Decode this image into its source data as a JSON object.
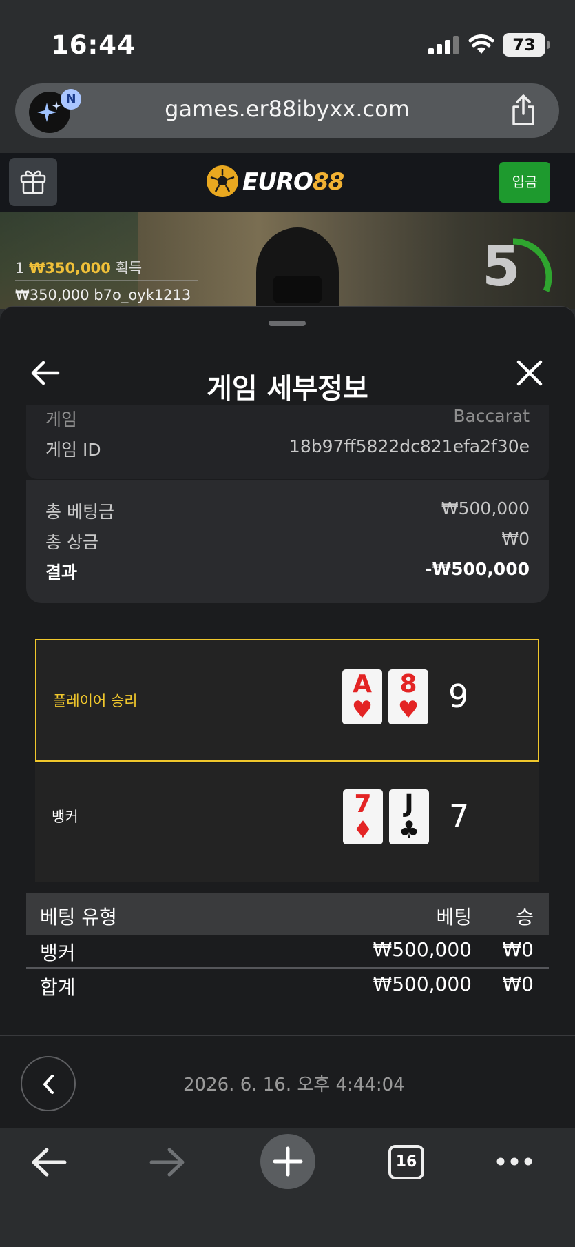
{
  "status_bar": {
    "time": "16:44",
    "battery": "73"
  },
  "browser": {
    "url": "games.er88ibyxx.com",
    "ai_badge": "N",
    "tabs_count": "16"
  },
  "site": {
    "brand_prefix": "EURO",
    "brand_suffix": "88",
    "deposit_label": "입금"
  },
  "live": {
    "win_prefix": "1",
    "win_amount": "₩350,000",
    "win_suffix": "획득",
    "bet_line": "₩350,000  b7o_oyk1213",
    "countdown": "5"
  },
  "sheet": {
    "title": "게임 세부정보",
    "game_label": "게임",
    "game_value": "Baccarat",
    "game_id_label": "게임 ID",
    "game_id_value": "18b97ff5822dc821efa2f30e",
    "total_bet_label": "총 베팅금",
    "total_bet_value": "₩500,000",
    "total_prize_label": "총 상금",
    "total_prize_value": "₩0",
    "result_label": "결과",
    "result_value": "-₩500,000"
  },
  "results": {
    "player": {
      "label": "플레이어 승리",
      "cards": [
        {
          "rank": "A",
          "suit": "♥"
        },
        {
          "rank": "8",
          "suit": "♥"
        }
      ],
      "score": "9"
    },
    "banker": {
      "label": "뱅커",
      "cards": [
        {
          "rank": "7",
          "suit": "♦"
        },
        {
          "rank": "J",
          "suit": "♣"
        }
      ],
      "score": "7"
    }
  },
  "bet_table": {
    "headers": [
      "베팅 유형",
      "베팅",
      "승"
    ],
    "rows": [
      {
        "type": "뱅커",
        "bet": "₩500,000",
        "win": "₩0"
      },
      {
        "type": "합계",
        "bet": "₩500,000",
        "win": "₩0"
      }
    ]
  },
  "footer": {
    "timestamp": "2026. 6. 16. 오후 4:44:04"
  },
  "colors": {
    "accent_yellow": "#f0c72c",
    "deposit_green": "#1e9a2e",
    "card_red": "#e32424"
  },
  "icons": [
    "signal-icon",
    "wifi-icon",
    "battery-icon",
    "ai-sparkle-icon",
    "share-icon",
    "gift-icon",
    "soccer-ball-icon",
    "back-arrow-icon",
    "close-icon",
    "chevron-left-icon",
    "forward-arrow-icon",
    "plus-icon",
    "more-icon"
  ]
}
